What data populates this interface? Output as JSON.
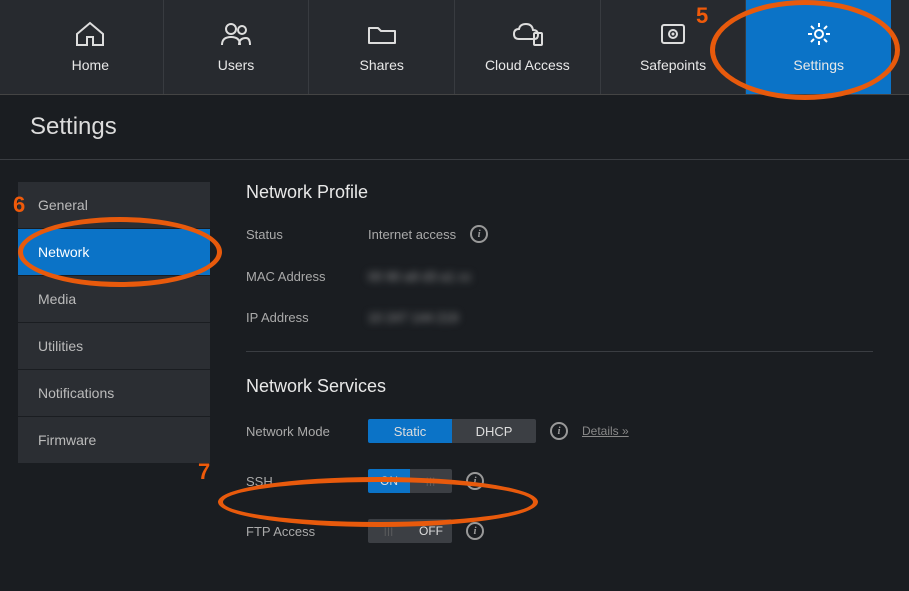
{
  "topnav": [
    {
      "label": "Home",
      "icon": "home-icon"
    },
    {
      "label": "Users",
      "icon": "users-icon"
    },
    {
      "label": "Shares",
      "icon": "folder-icon"
    },
    {
      "label": "Cloud Access",
      "icon": "cloud-icon"
    },
    {
      "label": "Safepoints",
      "icon": "safe-icon"
    },
    {
      "label": "Settings",
      "icon": "gear-icon"
    }
  ],
  "page_title": "Settings",
  "sidebar": {
    "items": [
      {
        "label": "General"
      },
      {
        "label": "Network"
      },
      {
        "label": "Media"
      },
      {
        "label": "Utilities"
      },
      {
        "label": "Notifications"
      },
      {
        "label": "Firmware"
      }
    ]
  },
  "profile": {
    "heading": "Network Profile",
    "status_label": "Status",
    "status_value": "Internet access",
    "mac_label": "MAC Address",
    "mac_value": "00 90 a9 d3 a1 cc",
    "ip_label": "IP Address",
    "ip_value": "10 247 144 219"
  },
  "services": {
    "heading": "Network Services",
    "mode_label": "Network Mode",
    "mode_static": "Static",
    "mode_dhcp": "DHCP",
    "details": "Details »",
    "ssh_label": "SSH",
    "ssh_value": "ON",
    "ftp_label": "FTP Access",
    "ftp_value": "OFF"
  },
  "annotations": {
    "n5": "5",
    "n6": "6",
    "n7": "7"
  }
}
